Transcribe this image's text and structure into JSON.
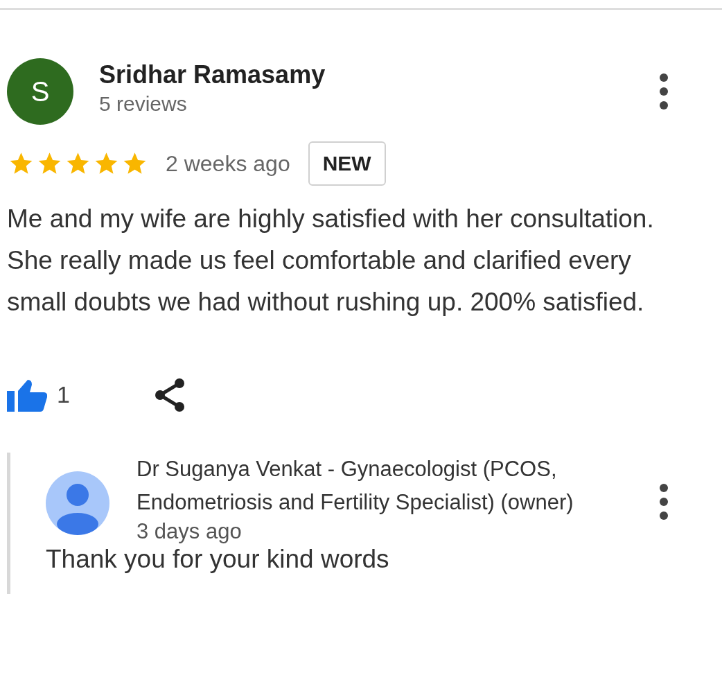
{
  "review": {
    "avatar_letter": "S",
    "name": "Sridhar Ramasamy",
    "reviews": "5 reviews",
    "stars": 5,
    "time": "2 weeks ago",
    "badge": "NEW",
    "text": "Me and my wife are highly satisfied with her consultation. She really made us feel comfortable and clarified every small doubts we had without rushing up. 200% satisfied.",
    "likes": "1"
  },
  "reply": {
    "name": "Dr Suganya Venkat - Gynaecologist (PCOS, Endometriosis and Fertility Specialist) (owner)",
    "time": "3 days ago",
    "text": "Thank you for your kind words"
  }
}
